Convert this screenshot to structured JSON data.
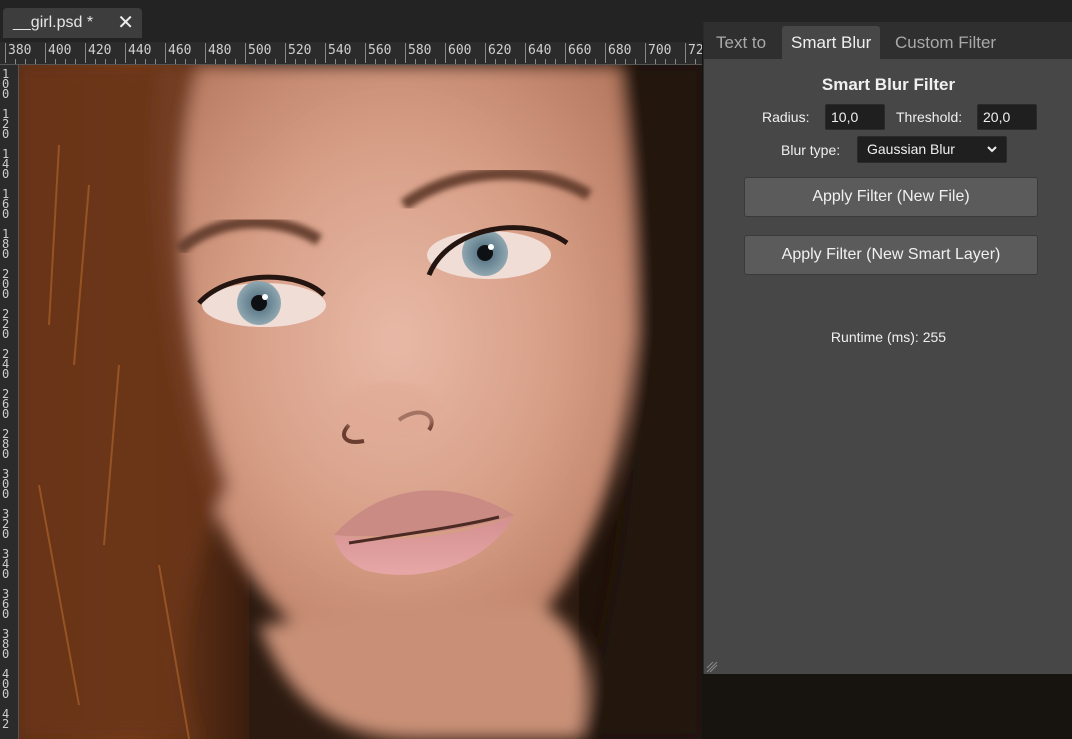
{
  "document_tab": {
    "title": "__girl.psd *",
    "close_glyph": "✕"
  },
  "ruler": {
    "top_labels": [
      "380",
      "400",
      "420",
      "440",
      "460",
      "480",
      "500",
      "520",
      "540",
      "560",
      "580",
      "600",
      "620",
      "640",
      "660",
      "680",
      "700",
      "72"
    ],
    "left_labels": [
      "100",
      "120",
      "140",
      "160",
      "180",
      "200",
      "220",
      "240",
      "260",
      "280",
      "300",
      "320",
      "340",
      "360",
      "380",
      "400",
      "42"
    ]
  },
  "panel": {
    "tabs": [
      {
        "label": "Text to",
        "active": false
      },
      {
        "label": "Smart Blur",
        "active": true
      },
      {
        "label": "Custom Filter",
        "active": false
      }
    ],
    "title": "Smart Blur Filter",
    "radius_label": "Radius:",
    "radius_value": "10,0",
    "threshold_label": "Threshold:",
    "threshold_value": "20,0",
    "blur_type_label": "Blur type:",
    "blur_type_value": "Gaussian Blur",
    "apply_new_file": "Apply Filter (New File)",
    "apply_new_smart_layer": "Apply Filter (New Smart Layer)",
    "runtime_text": "Runtime (ms): 255"
  },
  "colors": {
    "panel_bg": "#474747",
    "tab_bar_bg": "#2f2f2f",
    "button_bg": "#5b5b5b",
    "input_bg": "#1f1f1f"
  }
}
